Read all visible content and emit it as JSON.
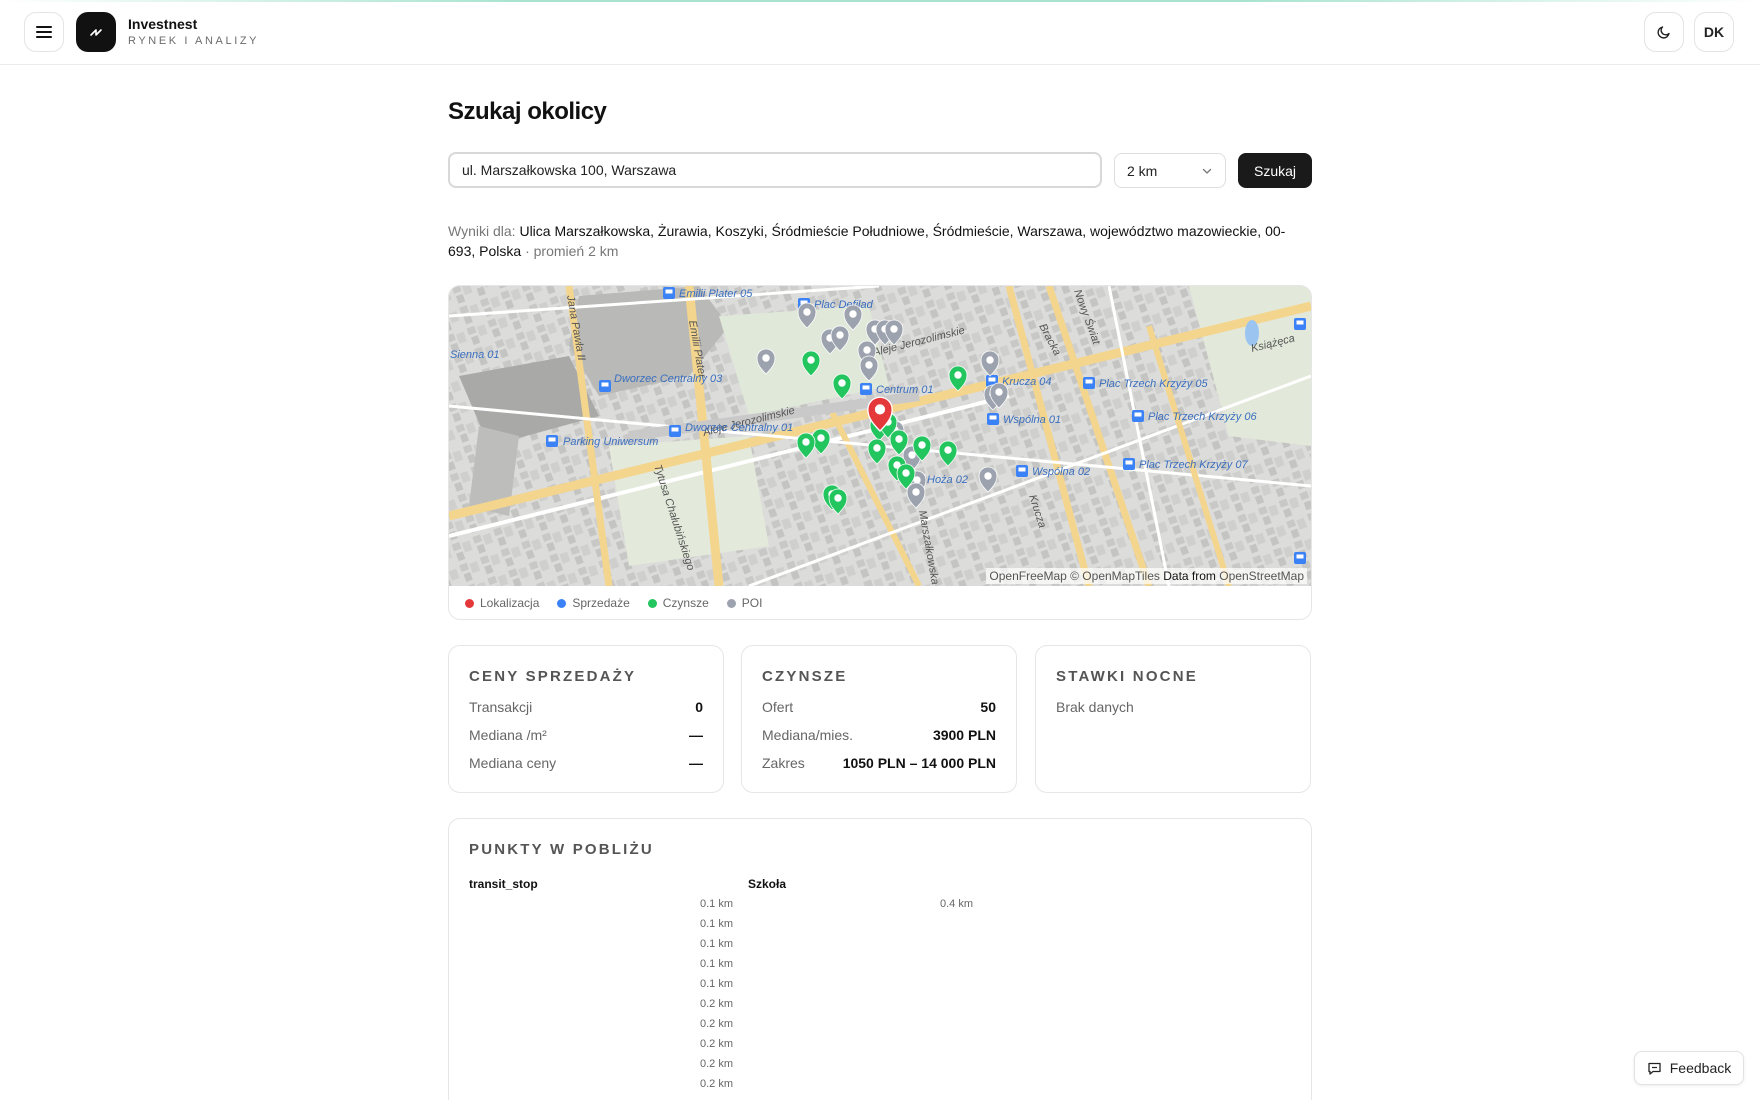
{
  "header": {
    "brand_name": "Investnest",
    "brand_subtitle": "RYNEK I ANALIZY",
    "avatar_initials": "DK"
  },
  "search": {
    "title": "Szukaj okolicy",
    "address_value": "ul. Marszałkowska 100, Warszawa",
    "radius_value": "2 km",
    "submit_label": "Szukaj"
  },
  "results": {
    "prefix": "Wyniki dla:",
    "address": "Ulica Marszałkowska, Żurawia, Koszyki, Śródmieście Południowe, Śródmieście, Warszawa, województwo mazowieckie, 00-693, Polska",
    "suffix": "· promień 2 km"
  },
  "map": {
    "attribution_a": "OpenFreeMap © OpenMapTiles",
    "attribution_b": "Data from",
    "attribution_c": "OpenStreetMap",
    "labels": {
      "emilii_plater_05": "Emilii Plater 05",
      "plac_defilad": "Plac Defilad",
      "sienna_01": "Sienna 01",
      "dworzec_centralny_03": "Dworzec Centralny 03",
      "dworzec_centralny_01": "Dworzec Centralny 01",
      "parking_uniwersum": "Parking Uniwersum",
      "centrum_01": "Centrum 01",
      "krucza_04": "Krucza 04",
      "wspolna_01": "Wspólna 01",
      "wspolna_02": "Wspólna 02",
      "hoza_02": "Hoża 02",
      "plac_trzech_krzyzy_05": "Plac Trzech Krzyży 05",
      "plac_trzech_krzyzy_06": "Plac Trzech Krzyży 06",
      "plac_trzech_krzyzy_07": "Plac Trzech Krzyży 07",
      "aleje_jerozolimskie": "Aleje Jerozolimskie",
      "ksiazeca": "Książęca",
      "emilii_plater": "Emilii Plater",
      "nowy_swiat": "Nowy Świat",
      "tytusa_chalubinskiego": "Tytusa Chałubińskiego",
      "marszalkowska": "Marszałkowska",
      "bracka": "Bracka",
      "krucza": "Krucza",
      "jana_pawla_ii": "Jana Pawła II"
    },
    "colors": {
      "location": "#e5383b",
      "sales": "#3b82f6",
      "rents": "#22c55e",
      "poi": "#9ca3af"
    }
  },
  "legend": {
    "location": "Lokalizacja",
    "sales": "Sprzedaże",
    "rents": "Czynsze",
    "poi": "POI"
  },
  "sales_card": {
    "title": "CENY SPRZEDAŻY",
    "rows": [
      {
        "label": "Transakcji",
        "value": "0"
      },
      {
        "label": "Mediana /m²",
        "value": "—"
      },
      {
        "label": "Mediana ceny",
        "value": "—"
      }
    ]
  },
  "rents_card": {
    "title": "CZYNSZE",
    "rows": [
      {
        "label": "Ofert",
        "value": "50"
      },
      {
        "label": "Mediana/mies.",
        "value": "3900 PLN"
      },
      {
        "label": "Zakres",
        "value": "1050 PLN – 14 000 PLN"
      }
    ]
  },
  "nightly_card": {
    "title": "STAWKI NOCNE",
    "empty": "Brak danych"
  },
  "nearby": {
    "title": "PUNKTY W POBLIŻU",
    "columns": [
      {
        "title": "transit_stop",
        "distances": [
          "0.1 km",
          "0.1 km",
          "0.1 km",
          "0.1 km",
          "0.1 km",
          "0.2 km",
          "0.2 km",
          "0.2 km",
          "0.2 km",
          "0.2 km"
        ]
      },
      {
        "title": "Szkoła",
        "distances": [
          "0.4 km"
        ]
      }
    ]
  },
  "feedback_label": "Feedback"
}
